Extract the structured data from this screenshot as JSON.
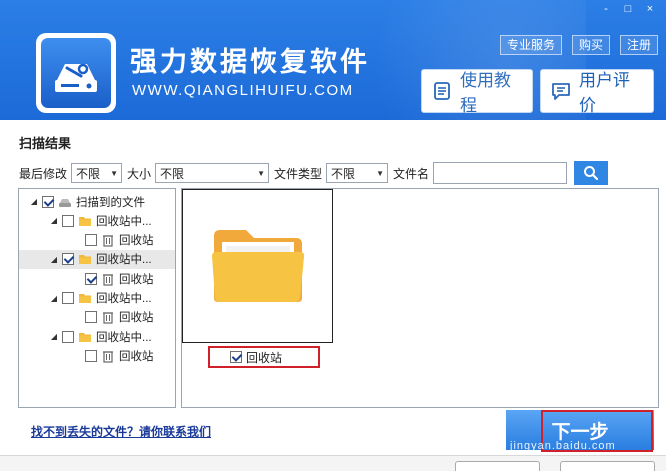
{
  "window": {
    "controls": [
      "-",
      "□",
      "×"
    ]
  },
  "brand": {
    "title": "强力数据恢复软件",
    "url": "WWW.QIANGLIHUIFU.COM"
  },
  "top_links": [
    "专业服务",
    "购买",
    "注册"
  ],
  "header_buttons": {
    "tutorial": "使用教程",
    "review": "用户评价"
  },
  "scan": {
    "title": "扫描结果"
  },
  "filters": {
    "modified_label": "最后修改",
    "modified_value": "不限",
    "size_label": "大小",
    "size_value": "不限",
    "type_label": "文件类型",
    "type_value": "不限",
    "name_label": "文件名",
    "name_value": ""
  },
  "tree": [
    {
      "label": "扫描到的文件",
      "level": 0,
      "checked": true,
      "expanded": true,
      "icon": "drive-icon"
    },
    {
      "label": "回收站中...",
      "level": 1,
      "checked": false,
      "expanded": true,
      "icon": "folder-icon"
    },
    {
      "label": "回收站",
      "level": 2,
      "checked": false,
      "icon": "recycle-bin-icon"
    },
    {
      "label": "回收站中...",
      "level": 1,
      "checked": true,
      "expanded": true,
      "selected": true,
      "icon": "folder-icon"
    },
    {
      "label": "回收站",
      "level": 2,
      "checked": true,
      "icon": "recycle-bin-icon"
    },
    {
      "label": "回收站中...",
      "level": 1,
      "checked": false,
      "expanded": true,
      "icon": "folder-icon"
    },
    {
      "label": "回收站",
      "level": 2,
      "checked": false,
      "icon": "recycle-bin-icon"
    },
    {
      "label": "回收站中...",
      "level": 1,
      "checked": false,
      "expanded": true,
      "icon": "folder-icon"
    },
    {
      "label": "回收站",
      "level": 2,
      "checked": false,
      "icon": "recycle-bin-icon"
    }
  ],
  "preview": {
    "item_label": "回收站",
    "item_checked": true
  },
  "footer": {
    "help_link": "找不到丢失的文件？请你联系我们",
    "next_button": "下一步",
    "watermark": "jingyan.baidu.com"
  },
  "colors": {
    "header_blue": "#1c6ad8",
    "accent_blue": "#2f86e3",
    "highlight_red": "#d0202a",
    "folder_yellow": "#f6c343"
  }
}
